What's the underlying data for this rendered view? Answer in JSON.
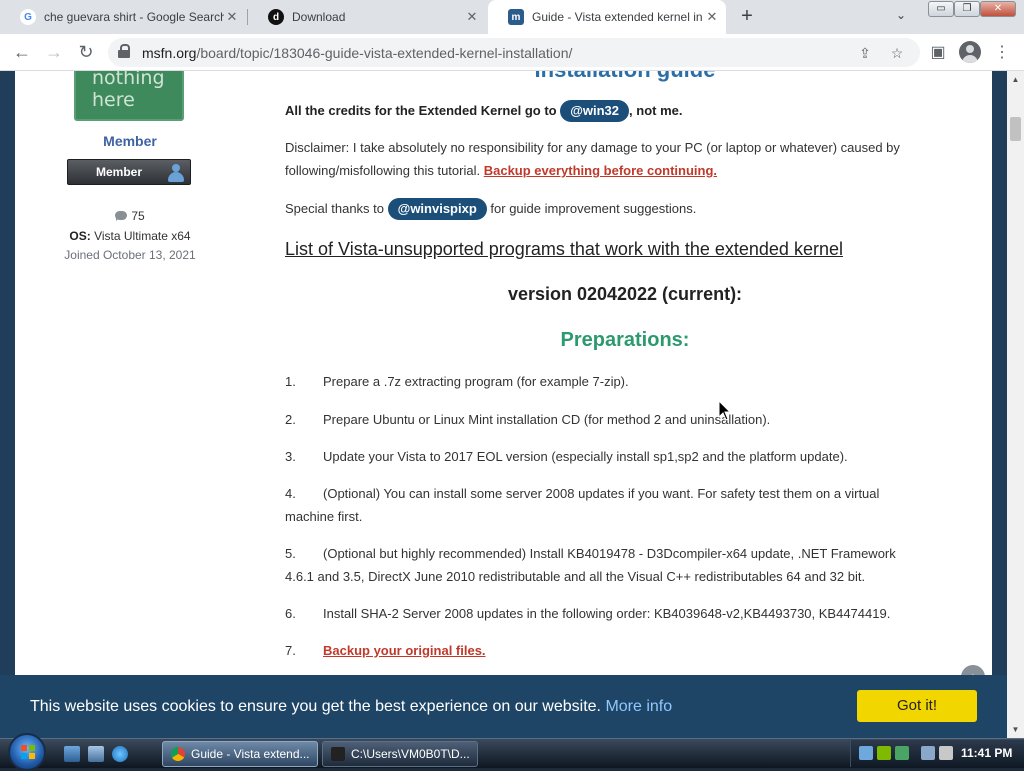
{
  "tabs": [
    {
      "title": "che guevara shirt - Google Search",
      "favicon": "google-g-icon"
    },
    {
      "title": "Download",
      "favicon": "dot-icon"
    },
    {
      "title": "Guide - Vista extended kernel installation",
      "favicon": "msfn-icon",
      "active": true
    }
  ],
  "tab_close_glyph": "✕",
  "new_tab_glyph": "+",
  "window_controls": {
    "minimize": "▭",
    "maximize": "❐",
    "close": "✕"
  },
  "omnibox": {
    "host": "msfn.org",
    "path": "/board/topic/183046-guide-vista-extended-kernel-installation/"
  },
  "sidebar": {
    "avatar_text_line1": "nothing",
    "avatar_text_line2": "here",
    "member_title": "Member",
    "badge_label": "Member",
    "posts_count": "75",
    "os_label": "OS:",
    "os_value": "Vista Ultimate x64",
    "joined": "Joined October 13, 2021"
  },
  "article": {
    "heading_cut": "Installation guide",
    "credits_prefix": "All the credits for the Extended Kernel go to",
    "credits_mention": "@win32",
    "credits_suffix": ", not me.",
    "disclaimer_line1": "Disclaimer: I take absolutely no responsibility for any damage to your PC (or laptop or whatever) caused by",
    "disclaimer_line2_prefix": "following/misfollowing this tutorial.",
    "disclaimer_link": "Backup everything before continuing.",
    "thanks_prefix": "Special thanks to",
    "thanks_mention": "@winvispixp",
    "thanks_suffix": "for guide improvement suggestions.",
    "list_link": "List of Vista-unsupported programs that work with the extended kernel",
    "version": "version 02042022 (current):",
    "preparations": "Preparations:",
    "steps": [
      {
        "num": "1.",
        "text": "Prepare a .7z extracting program (for  example 7-zip)."
      },
      {
        "num": "2.",
        "text": "Prepare Ubuntu or Linux Mint installation CD (for method 2 and uninsallation)."
      },
      {
        "num": "3.",
        "text": "Update your Vista to 2017 EOL version (especially install sp1,sp2 and the platform update)."
      },
      {
        "num": "4.",
        "text": "(Optional) You can install some server 2008 updates if you want. For safety test them on a virtual",
        "text2": "machine first."
      },
      {
        "num": "5.",
        "text": "(Optional but highly recommended) Install KB4019478 - D3Dcompiler-x64 update, .NET Framework",
        "text2": "4.6.1 and 3.5, DirectX June 2010 redistributable and all the Visual C++ redistributables 64 and 32 bit."
      },
      {
        "num": "6.",
        "text": "Install SHA-2 Server 2008 updates in the following order: KB4039648-v2,KB4493730, KB4474419."
      },
      {
        "num": "7.",
        "text": "Backup your original files."
      }
    ]
  },
  "cookie": {
    "message": "This website uses cookies to ensure you get the best experience on our website.",
    "more_info": "More info",
    "button": "Got it!"
  },
  "taskbar": {
    "buttons": [
      {
        "label": "Guide - Vista extend...",
        "active": true
      },
      {
        "label": "C:\\Users\\VM0B0T\\D..."
      }
    ],
    "clock": "11:41 PM"
  },
  "colors": {
    "mention_bg": "#1b4f7a",
    "link_red": "#c0392b",
    "prep_green": "#2c9a6e",
    "cookie_bg": "#1f4566",
    "cookie_button": "#f1d600"
  }
}
